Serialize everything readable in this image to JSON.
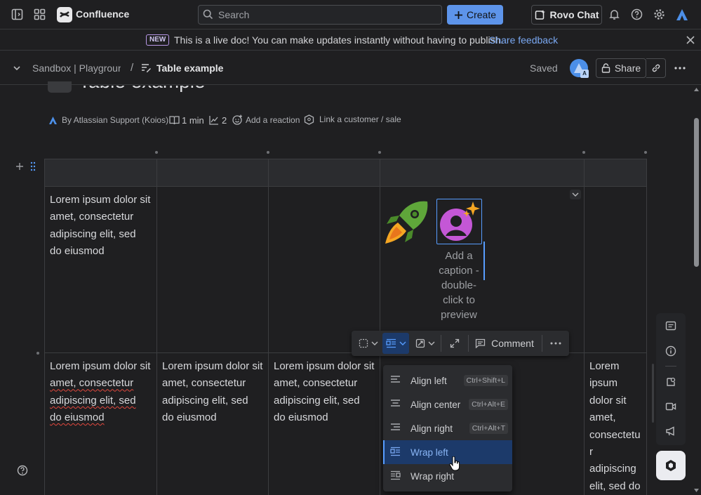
{
  "topnav": {
    "app_name": "Confluence",
    "search_placeholder": "Search",
    "create_label": "Create",
    "rovo_label": "Rovo Chat"
  },
  "banner": {
    "badge": "NEW",
    "message": "This is a live doc! You can make updates instantly without having to publish.",
    "link": "Share feedback"
  },
  "breadcrumb": {
    "space": "Sandbox | Playground",
    "separator": "/",
    "page": "Table example",
    "saved": "Saved",
    "avatar_badge": "A",
    "share_label": "Share"
  },
  "page": {
    "title": "Table example",
    "byline": "By Atlassian Support (Koios)",
    "read_time": "1 min",
    "views": "2",
    "reaction": "Add a reaction",
    "link_customer": "Link a customer / sale"
  },
  "table": {
    "cell_text": "Lorem ipsum dolor sit amet, consectetur adipiscing elit, sed do eiusmod",
    "row1": {
      "c1_lines": [
        "Lorem ipsum dolor sit",
        "amet, consectetur",
        "adipiscing elit, sed",
        "do eiusmod"
      ],
      "caption_lines": [
        "Add a",
        "caption -",
        "double-",
        "click to",
        "preview"
      ]
    },
    "row2": {
      "c1_lines": [
        "Lorem ipsum dolor sit",
        "amet, consectetur",
        "adipiscing elit, sed",
        "do eiusmod"
      ],
      "c2_lines": [
        "Lorem ipsum dolor sit",
        "amet, consectetur",
        "adipiscing elit, sed",
        "do eiusmod"
      ],
      "c3_lines": [
        "Lorem ipsum dolor sit",
        "amet, consectetur",
        "adipiscing elit, sed",
        "do eiusmod"
      ],
      "c5_lines": [
        "Lorem",
        "ipsum",
        "dolor sit",
        "amet,",
        "consectetu",
        "r",
        "adipiscing",
        "elit, sed do"
      ]
    }
  },
  "image_toolbar": {
    "comment_label": "Comment"
  },
  "align_menu": {
    "items": [
      {
        "label": "Align left",
        "shortcut": "Ctrl+Shift+L"
      },
      {
        "label": "Align center",
        "shortcut": "Ctrl+Alt+E"
      },
      {
        "label": "Align right",
        "shortcut": "Ctrl+Alt+T"
      },
      {
        "label": "Wrap left",
        "shortcut": ""
      },
      {
        "label": "Wrap right",
        "shortcut": ""
      }
    ],
    "selected": "Wrap left"
  },
  "colors": {
    "accent": "#579dff",
    "create_button": "#5d94ea",
    "background": "#1f1f21",
    "spellcheck": "#e2483d"
  },
  "icons": [
    "sidebar-toggle-icon",
    "app-switcher-icon",
    "confluence-logo-icon",
    "search-icon",
    "plus-icon",
    "rovo-chat-icon",
    "bell-icon",
    "help-icon",
    "settings-icon",
    "atlassian-logo-icon",
    "close-icon",
    "chevron-down-icon",
    "page-icon",
    "lock-icon",
    "link-icon",
    "more-icon",
    "book-icon",
    "chart-icon",
    "emoji-icon",
    "customer-icon",
    "rocket-icon",
    "avatar-sparkle-icon",
    "comment-icon",
    "info-icon",
    "video-icon",
    "megaphone-icon",
    "loom-icon"
  ]
}
